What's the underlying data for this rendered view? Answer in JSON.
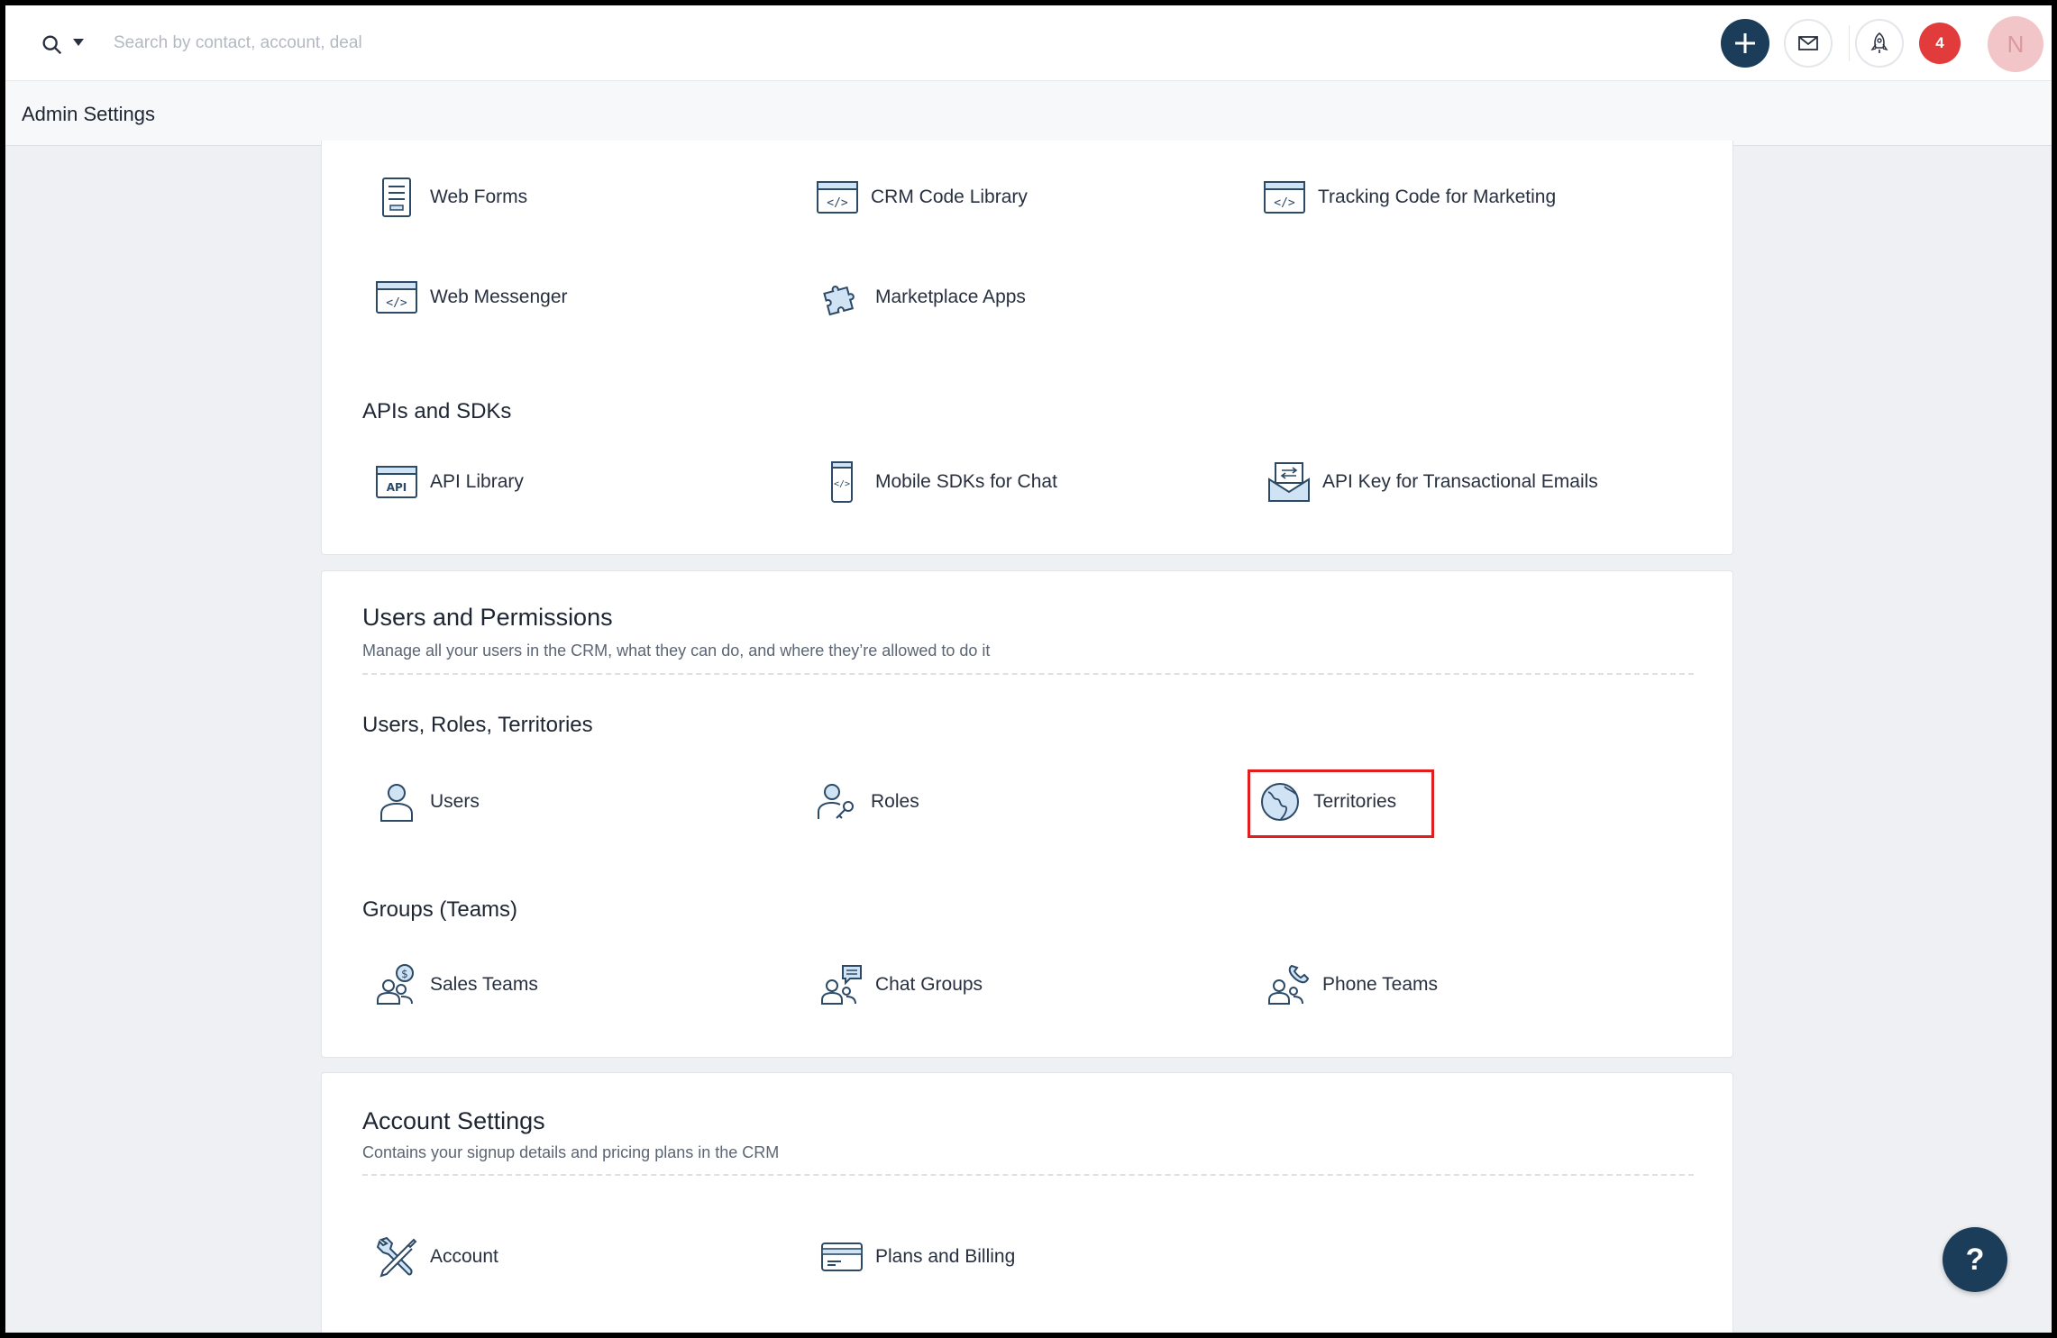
{
  "search": {
    "placeholder": "Search by contact, account, deal"
  },
  "topbar": {
    "notification_count": "4",
    "avatar_initial": "N"
  },
  "header": {
    "title": "Admin Settings"
  },
  "card_integrations": {
    "items": [
      {
        "label": "Web Forms",
        "icon": "web-form-icon"
      },
      {
        "label": "CRM Code Library",
        "icon": "code-window-icon"
      },
      {
        "label": "Tracking Code for Marketing",
        "icon": "code-window-icon"
      },
      {
        "label": "Web Messenger",
        "icon": "code-window-icon"
      },
      {
        "label": "Marketplace Apps",
        "icon": "puzzle-icon"
      }
    ],
    "apis_title": "APIs and SDKs",
    "apis_items": [
      {
        "label": "API Library",
        "icon": "api-icon"
      },
      {
        "label": "Mobile SDKs for Chat",
        "icon": "mobile-code-icon"
      },
      {
        "label": "API Key for Transactional Emails",
        "icon": "email-key-icon"
      }
    ]
  },
  "users_permissions": {
    "title": "Users and Permissions",
    "description": "Manage all your users in the CRM, what they can do, and where they’re allowed to do it",
    "group1_title": "Users, Roles, Territories",
    "group1_items": [
      {
        "label": "Users",
        "icon": "user-icon"
      },
      {
        "label": "Roles",
        "icon": "user-key-icon"
      },
      {
        "label": "Territories",
        "icon": "globe-icon"
      }
    ],
    "group2_title": "Groups (Teams)",
    "group2_items": [
      {
        "label": "Sales Teams",
        "icon": "sales-team-icon"
      },
      {
        "label": "Chat Groups",
        "icon": "chat-group-icon"
      },
      {
        "label": "Phone Teams",
        "icon": "phone-team-icon"
      }
    ]
  },
  "account_settings": {
    "title": "Account Settings",
    "description": "Contains your signup details and pricing plans in the CRM",
    "items": [
      {
        "label": "Account",
        "icon": "tools-icon"
      },
      {
        "label": "Plans and Billing",
        "icon": "credit-card-icon"
      }
    ]
  },
  "help": {
    "label": "?"
  },
  "colors": {
    "primary": "#1c3d5a",
    "badge": "#e23b3b",
    "highlight": "#e21d1d",
    "icon_fill": "#cfe3f5",
    "icon_stroke": "#2c4a66"
  }
}
